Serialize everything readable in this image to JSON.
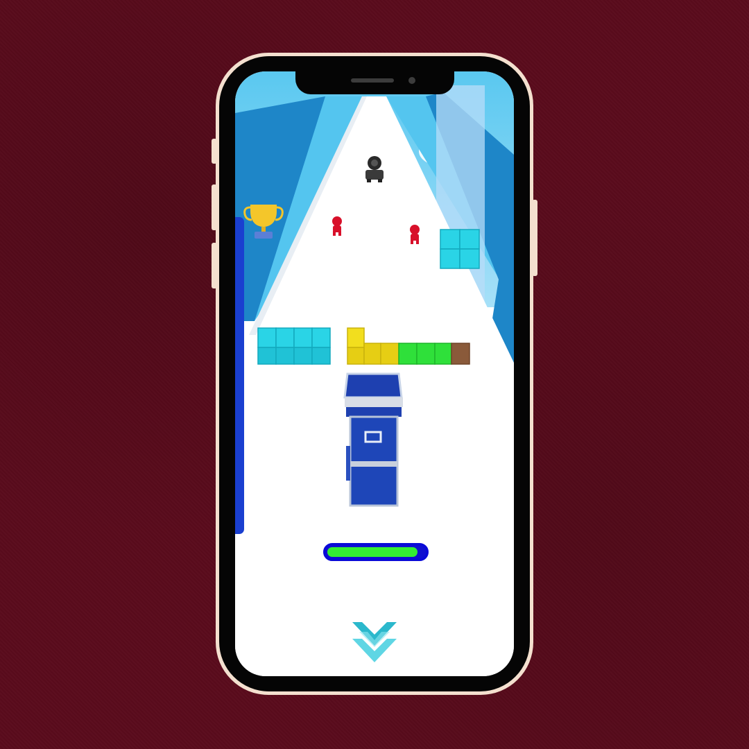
{
  "colors": {
    "background": "#5a0b1c",
    "phone_bezel": "#f4e0cf",
    "road": "#ffffff",
    "rail": "#29a3e0",
    "cyan_block": "#2ad4e6",
    "yellow_block": "#f2de1e",
    "green_block": "#2fe03a",
    "brown_block": "#8a5a3a",
    "player": "#1e40b0",
    "progress_fill": "#33ee33",
    "progress_border": "#0a0ad8",
    "enemy": "#d8102a"
  },
  "game": {
    "progress": 0.93,
    "side_meter_level": 1.0,
    "icons": [
      "trophy-icon",
      "swipe-down-icon",
      "enemy-figure",
      "enemy-vehicle"
    ]
  }
}
